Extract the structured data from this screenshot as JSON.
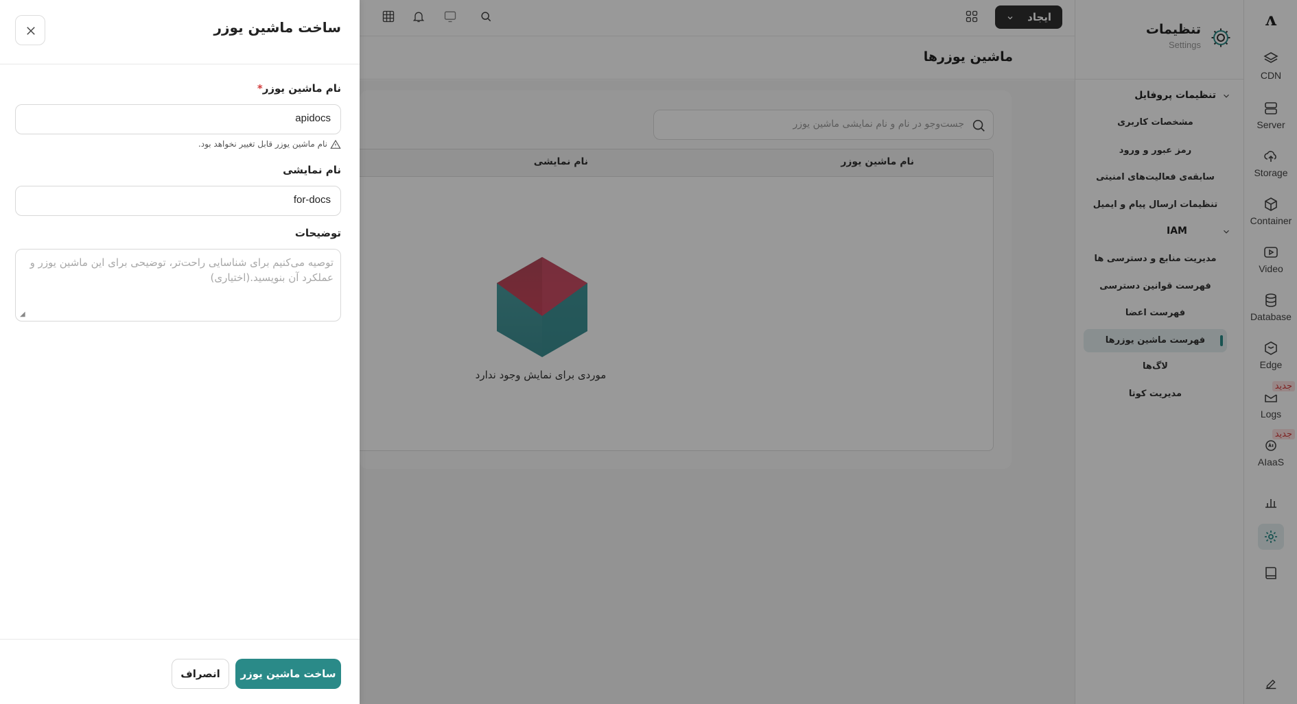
{
  "rail": {
    "logo": "ʌ",
    "items": [
      {
        "label": "CDN",
        "icon": "layers-icon"
      },
      {
        "label": "Server",
        "icon": "server-icon"
      },
      {
        "label": "Storage",
        "icon": "cloud-upload-icon"
      },
      {
        "label": "Container",
        "icon": "box-icon"
      },
      {
        "label": "Video",
        "icon": "video-icon"
      },
      {
        "label": "Database",
        "icon": "database-icon"
      },
      {
        "label": "Edge",
        "icon": "edge-icon"
      },
      {
        "label": "Logs",
        "icon": "logs-icon",
        "badge": "جدید"
      },
      {
        "label": "AIaaS",
        "icon": "ai-icon",
        "badge": "جدید"
      }
    ]
  },
  "settings": {
    "title": "تنظیمات",
    "subtitle": "Settings",
    "groups": [
      {
        "label": "تنظیمات پروفایل",
        "items": [
          "مشخصات کاربری",
          "رمز عبور و ورود",
          "سابقه‌ی فعالیت‌های امنیتی",
          "تنظیمات ارسال پیام و ایمیل"
        ]
      },
      {
        "label": "IAM",
        "items": [
          "مدیریت منابع و دسترسی ها",
          "فهرست قوانین دسترسی",
          "فهرست اعضا",
          "فهرست ماشین یوزرها",
          "لاگ‌ها",
          "مدیریت کوتا"
        ]
      }
    ]
  },
  "topbar": {
    "create_label": "ایجاد"
  },
  "main": {
    "page_title": "ماشین یوزرها",
    "search_placeholder": "جست‌وجو در نام و نام نمایشی ماشین یوزر",
    "columns": [
      "نام ماشین یوزر",
      "نام نمایشی"
    ],
    "empty_text": "موردی برای نمایش وجود ندارد"
  },
  "drawer": {
    "title": "ساخت ماشین یوزر",
    "name_label": "نام ماشین یوزر",
    "required_mark": "*",
    "name_value": "apidocs",
    "name_hint": "نام ماشین یوزر قابل تغییر نخواهد بود.",
    "display_label": "نام نمایشی",
    "display_value": "for-docs",
    "desc_label": "توضیحات",
    "desc_placeholder": "توصیه می‌کنیم برای شناسایی راحت‌تر، توضیحی برای این ماشین یوزر و عملکرد آن بنویسید.(اختیاری)",
    "submit_label": "ساخت ماشین یوزر",
    "cancel_label": "انصراف"
  },
  "colors": {
    "primary": "#2a8a88",
    "dark_button": "#2f2f2f",
    "badge_text": "#d23b3b"
  }
}
